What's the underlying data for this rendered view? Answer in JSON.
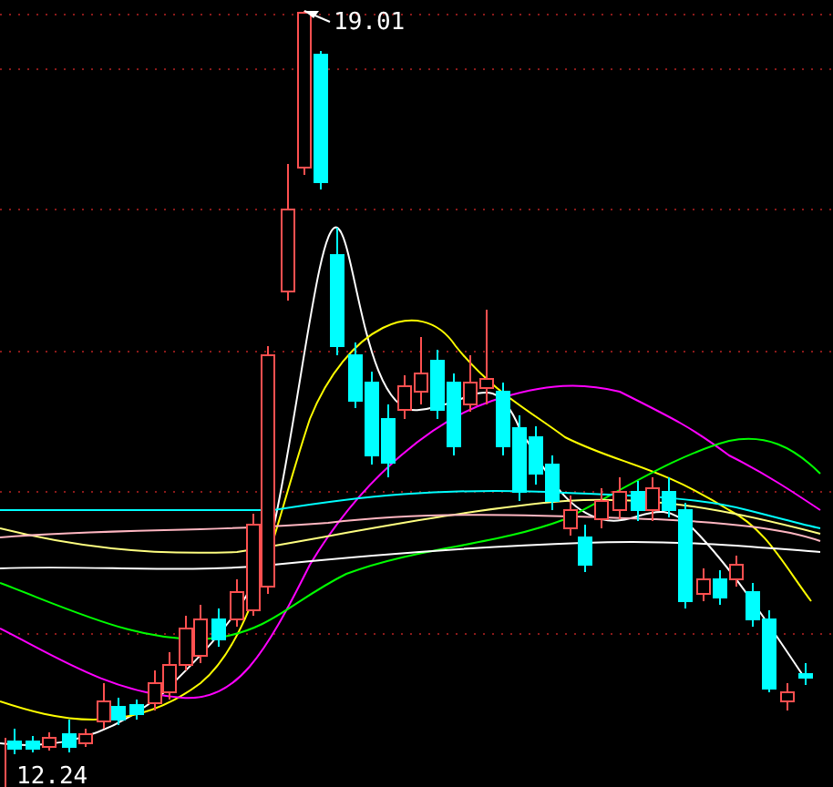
{
  "chart": {
    "high_label": "19.01",
    "low_label": "12.24"
  }
}
